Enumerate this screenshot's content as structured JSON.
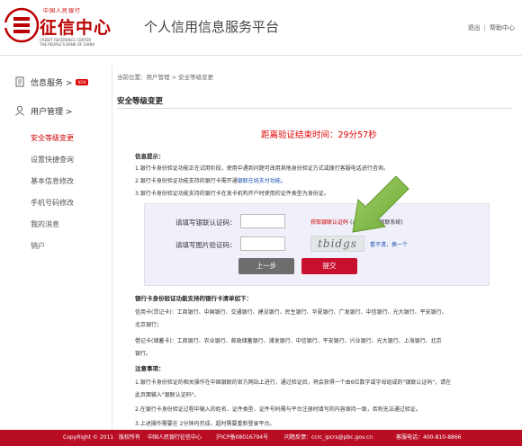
{
  "header": {
    "logo_top": "中国人民银行",
    "logo_main": "征信中心",
    "logo_en_line1": "CREDIT REFERENCE CENTER",
    "logo_en_line2": "THE PEOPLE'S BANK OF CHINA",
    "site_title": "个人信用信息服务平台",
    "logout": "退出",
    "help": "帮助中心"
  },
  "sidebar": {
    "group_info": "信息服务 >",
    "new_badge": "NEW",
    "group_user": "用户管理 >",
    "items": [
      {
        "label": "安全等级变更"
      },
      {
        "label": "设置快捷查询"
      },
      {
        "label": "基本信息修改"
      },
      {
        "label": "手机号码修改"
      },
      {
        "label": "我的消息"
      },
      {
        "label": "销户"
      }
    ]
  },
  "main": {
    "breadcrumb": "当前位置：用户管理 > 安全等级变更",
    "page_title": "安全等级变更",
    "countdown_label": "距离验证结束时间：",
    "countdown_value": "29分57秒",
    "tips_title": "信息提示：",
    "tip1": "1.银行卡身份验证功能正在试用阶段，使用中遇到问题可改用其他身份验证方式或拨打客服电话进行咨询。",
    "tip2_prefix": "2.银行卡身份验证功能支持的银行卡需开通",
    "tip2_link": "银联在线支付功能。",
    "tip3": "3.银行卡身份验证功能支持的银行卡在发卡机构开户时使用的证件类型为身份证。",
    "form": {
      "unionpay_label": "请填写银联认证码：",
      "get_code": "获取银联认证码",
      "get_code_note": "(点击后进入银联系统)",
      "captcha_label": "请填写图片验证码：",
      "captcha_text": "tbidgs",
      "refresh": "看不清，换一个",
      "prev_button": "上一步",
      "submit_button": "提交"
    },
    "banks_title": "银行卡身份验证功能支持的银行卡清单如下：",
    "credit_line1": "信用卡(贷记卡)：工商银行、中国银行、交通银行、建设银行、民生银行、华夏银行、广发银行、中信银行、光大银行、平安银行、",
    "credit_line2": "北京银行；",
    "debit_line1": "借记卡(储蓄卡)：工商银行、农业银行、邮政储蓄银行、浦发银行、中信银行、平安银行、兴业银行、光大银行、上海银行、北京",
    "debit_line2": "银行。",
    "notice_title": "注意事项：",
    "notice1_line1": "1.银行卡身份验证的相关操作在中国银联的官方网站上进行，通过验证后，将会获得一个由6位数字或字母组成的\"银联认证码\"，请在",
    "notice1_line2": "此页面输入\"银联认证码\"。",
    "notice2": "2.在银行卡身份验证过程中输入的姓名、证件类型、证件号码需与平台注册时填写的内容保持一致，否则无法通过验证。",
    "notice3": "3.上述操作需要在 2分钟内完成，超时需要重新登录平台。"
  },
  "footer": {
    "copyright": "CopyRight © 2011",
    "rights": "版权所有",
    "owner": "中国人民银行征信中心",
    "icp": "沪ICP备08016794号",
    "feedback": "问题反馈：ccrc_ipcrs@pbc.gov.cn",
    "hotline": "客服电话：400-810-8866"
  },
  "colors": {
    "brand_red": "#c8102e",
    "footer_red": "#b90d24",
    "arrow_green": "#7cb342"
  }
}
